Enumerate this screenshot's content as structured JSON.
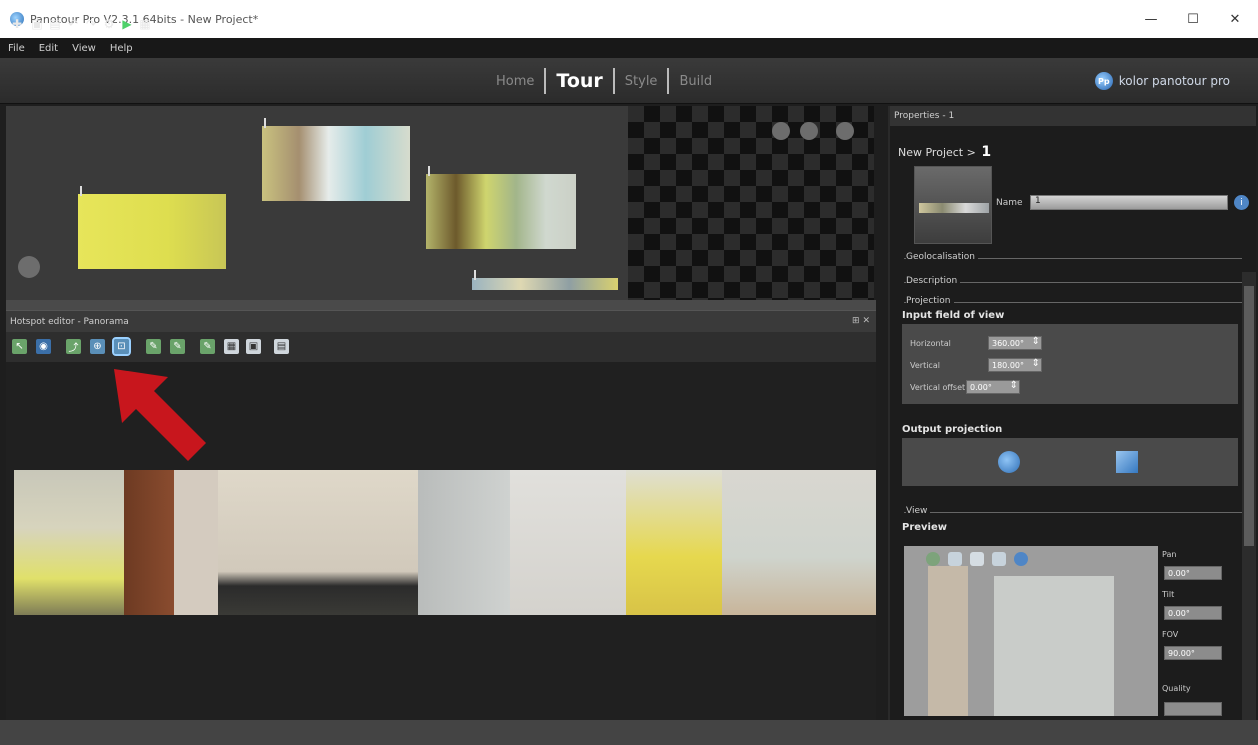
{
  "window": {
    "title": "Panotour Pro V2.3.1 64bits - New Project*",
    "minimize": "—",
    "maximize": "☐",
    "close": "✕"
  },
  "menu": [
    "File",
    "Edit",
    "View",
    "Help"
  ],
  "nav": {
    "home": "Home",
    "tour": "Tour",
    "style": "Style",
    "build": "Build"
  },
  "brand": {
    "logo": "Pp",
    "name": "kolor panotour pro"
  },
  "editor": {
    "header": "Hotspot editor - Panorama",
    "pin": "⊞ ✕"
  },
  "properties": {
    "header": "Properties - 1",
    "project": "New Project >",
    "project_index": "1",
    "name_label": "Name",
    "name_value": "1",
    "info": "i",
    "sections": {
      "geolocalisation": "Geolocalisation",
      "description": "Description",
      "projection": "Projection",
      "view": "View"
    },
    "input_fov_title": "Input field of view",
    "horizontal_label": "Horizontal",
    "horizontal_value": "360.00°",
    "vertical_label": "Vertical",
    "vertical_value": "180.00°",
    "vertical_offset_label": "Vertical offset",
    "vertical_offset_value": "0.00°",
    "output_projection_title": "Output projection",
    "preview_title": "Preview",
    "pan_label": "Pan",
    "pan_value": "0.00°",
    "tilt_label": "Tilt",
    "tilt_value": "0.00°",
    "fov_label": "FOV",
    "fov_value": "90.00°",
    "quality_label": "Quality"
  },
  "colors": {
    "accent_arrow": "#c8161d",
    "brand_blue": "#2563b0",
    "highlight": "#e6e04a"
  }
}
